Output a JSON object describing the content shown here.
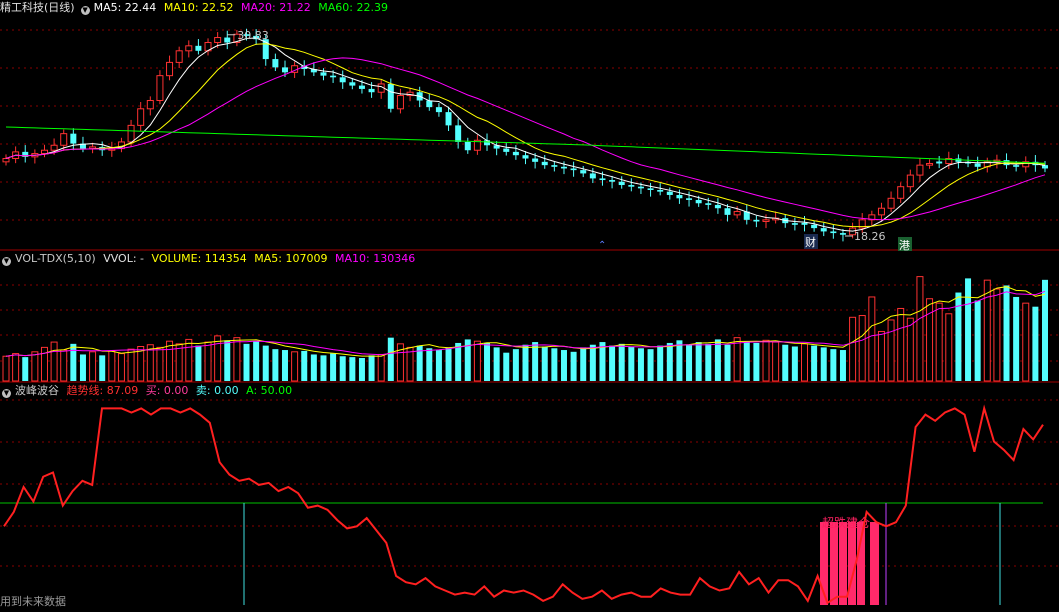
{
  "panels": {
    "price": {
      "title": "精工科技(日线)",
      "ma5": "MA5: 22.44",
      "ma10": "MA10: 22.52",
      "ma20": "MA20: 21.22",
      "ma60": "MA60: 22.39",
      "high_label": "30.83",
      "low_label": "18.26",
      "marker_cai": "财",
      "marker_gang": "港"
    },
    "volume": {
      "title": "VOL-TDX(5,10)",
      "vvol": "VVOL: -",
      "volume": "VOLUME: 114354",
      "ma5": "MA5: 107009",
      "ma10": "MA10: 130346"
    },
    "indicator": {
      "title": "波峰波谷",
      "trend": "趋势线: 87.09",
      "buy": "买: 0.00",
      "sell": "卖: 0.00",
      "a": "A: 50.00",
      "zone_label": "超跌建仓"
    }
  },
  "footer": "用到未来数据",
  "colors": {
    "up": "#ff3232",
    "down": "#54ffff",
    "ma5": "#ffffff",
    "ma10": "#ffff00",
    "ma20": "#ff00ff",
    "ma60": "#00ff00",
    "trend": "#ff2020",
    "zone": "#ff2a6a",
    "grid": "#8a0000"
  },
  "chart_data": [
    {
      "type": "candlestick",
      "title": "精工科技(日线)",
      "x": [
        1,
        2,
        3,
        4,
        5,
        6,
        7,
        8,
        9,
        10,
        11,
        12,
        13,
        14,
        15,
        16,
        17,
        18,
        19,
        20,
        21,
        22,
        23,
        24,
        25,
        26,
        27,
        28,
        29,
        30,
        31,
        32,
        33,
        34,
        35,
        36,
        37,
        38,
        39,
        40,
        41,
        42,
        43,
        44,
        45,
        46,
        47,
        48,
        49,
        50,
        51,
        52,
        53,
        54,
        55,
        56,
        57,
        58,
        59,
        60,
        61,
        62,
        63,
        64,
        65,
        66,
        67,
        68,
        69,
        70,
        71,
        72,
        73,
        74,
        75,
        76,
        77,
        78,
        79,
        80,
        81,
        82,
        83,
        84,
        85,
        86,
        87,
        88,
        89,
        90,
        91,
        92,
        93,
        94,
        95,
        96,
        97,
        98,
        99,
        100,
        101,
        102,
        103,
        104,
        105,
        106,
        107,
        108,
        109
      ],
      "close": [
        23.0,
        23.4,
        23.1,
        23.3,
        23.5,
        23.8,
        24.5,
        23.9,
        23.6,
        23.7,
        23.5,
        23.6,
        24.0,
        25.0,
        26.0,
        26.5,
        28.0,
        28.8,
        29.5,
        29.8,
        29.5,
        30.0,
        30.3,
        30.0,
        30.5,
        30.4,
        30.2,
        29.0,
        28.5,
        28.2,
        28.6,
        28.4,
        28.2,
        28.0,
        27.9,
        27.6,
        27.4,
        27.2,
        27.0,
        27.5,
        26.0,
        26.8,
        27.0,
        26.5,
        26.1,
        25.8,
        25.0,
        24.0,
        23.5,
        24.1,
        23.8,
        23.6,
        23.4,
        23.2,
        23.0,
        22.8,
        22.6,
        22.5,
        22.4,
        22.3,
        22.1,
        21.8,
        21.7,
        21.6,
        21.4,
        21.3,
        21.2,
        21.1,
        21.0,
        20.8,
        20.6,
        20.5,
        20.3,
        20.2,
        20.0,
        19.6,
        19.8,
        19.3,
        19.2,
        19.3,
        19.4,
        19.1,
        19.0,
        19.0,
        18.8,
        18.6,
        18.5,
        18.4,
        18.8,
        19.3,
        19.6,
        20.0,
        20.6,
        21.3,
        22.0,
        22.6,
        22.7,
        22.7,
        23.0,
        22.8,
        22.7,
        22.5,
        22.8,
        22.9,
        22.6,
        22.5,
        22.8,
        22.6,
        22.4
      ],
      "high_label": 30.83,
      "low_label": 18.26,
      "ma": {
        "MA5": 22.44,
        "MA10": 22.52,
        "MA20": 21.22,
        "MA60": 22.39
      }
    },
    {
      "type": "bar",
      "title": "VOL-TDX(5,10)",
      "series": [
        {
          "name": "VOLUME",
          "last": 114354
        },
        {
          "name": "MA5",
          "last": 107009
        },
        {
          "name": "MA10",
          "last": 130346
        }
      ],
      "values": [
        28000,
        31000,
        27000,
        33000,
        38000,
        44000,
        35000,
        42000,
        30000,
        33000,
        29000,
        34000,
        31000,
        36000,
        39000,
        41000,
        38000,
        45000,
        42000,
        47000,
        40000,
        44000,
        51000,
        46000,
        49000,
        42000,
        45000,
        40000,
        36000,
        35000,
        33000,
        34000,
        30000,
        29000,
        31000,
        28000,
        27000,
        26000,
        29000,
        30000,
        49000,
        42000,
        38000,
        40000,
        37000,
        35000,
        38000,
        43000,
        47000,
        45000,
        43000,
        38000,
        32000,
        36000,
        41000,
        44000,
        39000,
        37000,
        35000,
        33000,
        38000,
        41000,
        44000,
        40000,
        42000,
        39000,
        37000,
        36000,
        40000,
        43000,
        46000,
        41000,
        44000,
        42000,
        47000,
        41000,
        49000,
        45000,
        43000,
        46000,
        44000,
        41000,
        39000,
        42000,
        40000,
        38000,
        36000,
        35000,
        72000,
        74000,
        95000,
        56000,
        69000,
        82000,
        71000,
        118000,
        93000,
        88000,
        76000,
        100000,
        116000,
        91000,
        114000,
        104000,
        108000,
        95000,
        88000,
        84000,
        114354
      ],
      "ylim": [
        0,
        130000
      ]
    },
    {
      "type": "line",
      "title": "波峰波谷",
      "series": [
        {
          "name": "趋势线",
          "last": 87.09,
          "values": [
            38,
            45,
            57,
            50,
            62,
            64,
            48,
            55,
            60,
            58,
            95,
            95,
            95,
            93,
            95,
            92,
            95,
            95,
            93,
            95,
            92,
            88,
            69,
            63,
            60,
            61,
            58,
            59,
            55,
            57,
            54,
            47,
            48,
            46,
            41,
            37,
            38,
            42,
            36,
            30,
            14,
            11,
            10,
            13,
            9,
            7,
            5,
            6,
            5,
            9,
            4,
            7,
            6,
            7,
            5,
            2,
            4,
            10,
            6,
            3,
            4,
            7,
            3,
            5,
            6,
            4,
            4,
            8,
            6,
            5,
            5,
            13,
            9,
            7,
            8,
            16,
            10,
            13,
            6,
            12,
            12,
            9,
            2,
            14,
            1,
            4,
            4,
            22,
            45,
            40,
            38,
            40,
            48,
            86,
            92,
            89,
            93,
            95,
            92,
            74,
            95,
            79,
            75,
            70,
            85,
            80,
            87.09
          ]
        },
        {
          "name": "A",
          "last": 50.0
        }
      ],
      "buy": 0.0,
      "sell": 0.0,
      "annotations": [
        "超跌建仓"
      ],
      "ylim": [
        0,
        100
      ]
    }
  ]
}
